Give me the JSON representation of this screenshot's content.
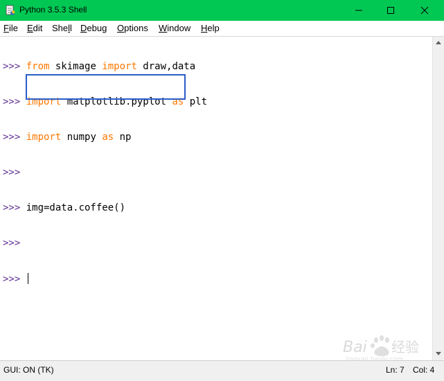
{
  "window": {
    "title": "Python 3.5.3 Shell"
  },
  "menu": [
    {
      "label": "File",
      "mnemonic": "F",
      "rest": "ile"
    },
    {
      "label": "Edit",
      "mnemonic": "E",
      "rest": "dit"
    },
    {
      "label": "Shell",
      "pre": "She",
      "mnemonic": "l",
      "rest": "l"
    },
    {
      "label": "Debug",
      "mnemonic": "D",
      "rest": "ebug"
    },
    {
      "label": "Options",
      "mnemonic": "O",
      "rest": "ptions"
    },
    {
      "label": "Window",
      "mnemonic": "W",
      "rest": "indow"
    },
    {
      "label": "Help",
      "mnemonic": "H",
      "rest": "elp"
    }
  ],
  "shell": {
    "prompt": ">>> ",
    "lines": [
      {
        "kw1": "from",
        "t1": " skimage ",
        "kw2": "import",
        "t2": " draw,data"
      },
      {
        "kw1": "import",
        "t1": " matplotlib.pyplot ",
        "kw2": "as",
        "t2": " plt"
      },
      {
        "kw1": "import",
        "t1": " numpy ",
        "kw2": "as",
        "t2": " np"
      },
      {
        "code": ""
      },
      {
        "code": "img=data.coffee()"
      },
      {
        "code": ""
      },
      {
        "code": ""
      }
    ]
  },
  "status": {
    "gui": "GUI: ON (TK)",
    "line": "Ln: 7",
    "col": "Col: 4"
  },
  "colors": {
    "titlebar": "#00c853",
    "prompt": "#5f2f91",
    "keyword": "#ff7700",
    "highlight_box": "#2a5cc9"
  }
}
